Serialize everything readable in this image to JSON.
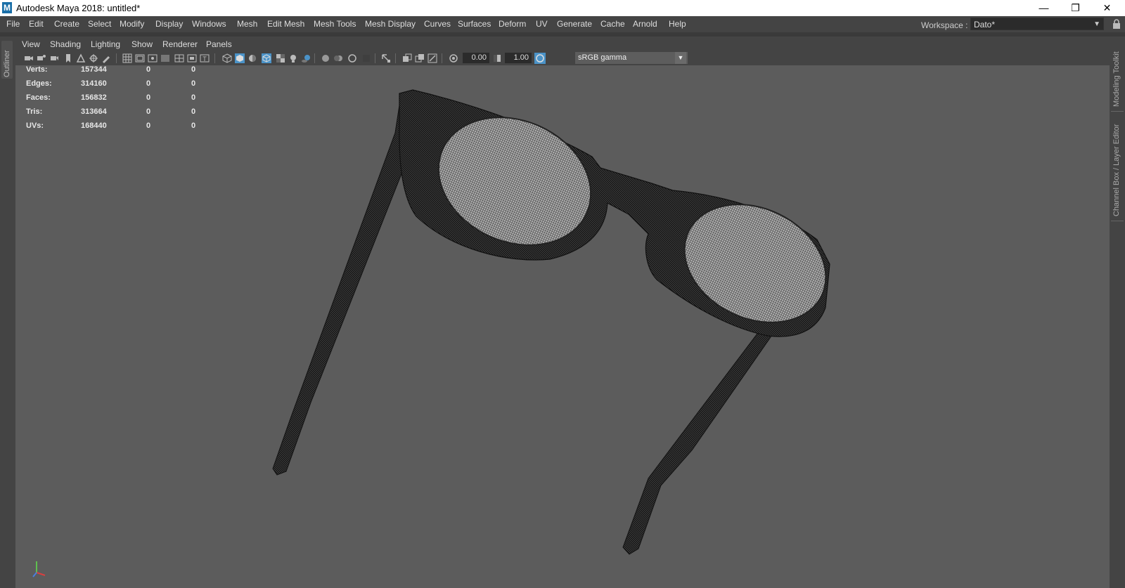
{
  "window": {
    "title": "Autodesk Maya 2018: untitled*",
    "app_icon_letter": "M",
    "minimize_glyph": "—",
    "restore_glyph": "❐",
    "close_glyph": "✕"
  },
  "menubar": {
    "items": [
      "File",
      "Edit",
      "Create",
      "Select",
      "Modify",
      "Display",
      "Windows",
      "Mesh",
      "Edit Mesh",
      "Mesh Tools",
      "Mesh Display",
      "Curves",
      "Surfaces",
      "Deform",
      "UV",
      "Generate",
      "Cache",
      "Arnold",
      "Help"
    ],
    "workspace_label": "Workspace :",
    "workspace_value": "Dato*"
  },
  "left_sidebar": {
    "outliner_label": "Outliner"
  },
  "right_sidebar": {
    "modeling_toolkit_label": "Modeling Toolkit",
    "channel_box_label": "Channel Box / Layer Editor"
  },
  "panel_menu": {
    "items": [
      "View",
      "Shading",
      "Lighting",
      "Show",
      "Renderer",
      "Panels"
    ]
  },
  "panel_toolbar": {
    "exposure_value": "0.00",
    "gamma_value": "1.00",
    "color_space": "sRGB gamma"
  },
  "hud": {
    "rows": [
      {
        "label": "Verts:",
        "total": "157344",
        "selected": "0",
        "components": "0"
      },
      {
        "label": "Edges:",
        "total": "314160",
        "selected": "0",
        "components": "0"
      },
      {
        "label": "Faces:",
        "total": "156832",
        "selected": "0",
        "components": "0"
      },
      {
        "label": "Tris:",
        "total": "313664",
        "selected": "0",
        "components": "0"
      },
      {
        "label": "UVs:",
        "total": "168440",
        "selected": "0",
        "components": "0"
      }
    ]
  },
  "colors": {
    "viewport_bg": "#5c5c5c",
    "ui_bg": "#444444",
    "mesh_wire": "#111111",
    "lens_fill": "#b0b0b0",
    "active_icon": "#4b93c8"
  },
  "viewport": {
    "object": "eyeglasses wireframe mesh"
  }
}
